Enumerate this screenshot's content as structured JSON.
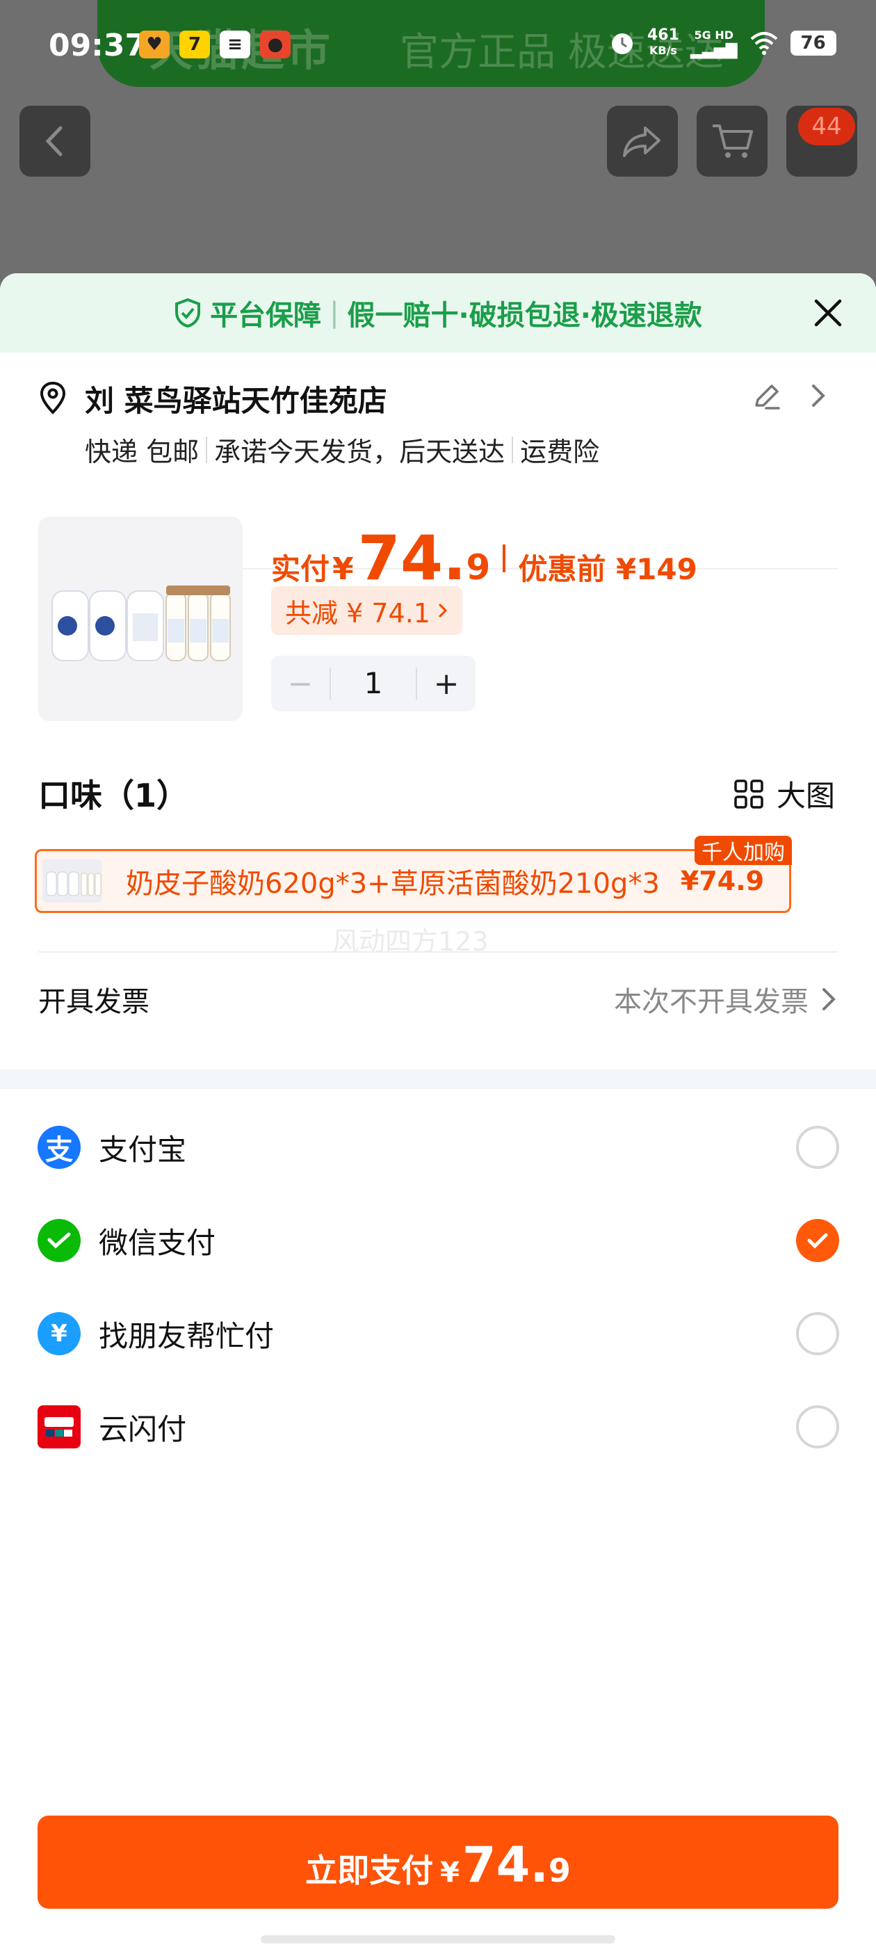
{
  "status_bar": {
    "time": "09:37",
    "net_speed": "461",
    "net_unit": "KB/s",
    "network": "5G HD",
    "battery": "76"
  },
  "background_page": {
    "banner_brand": "天猫超市",
    "banner_slogan": "官方正品 极速送达",
    "cart_badge": "44"
  },
  "guarantee": {
    "left": "平台保障",
    "right": "假一赔十·破损包退·极速退款"
  },
  "address": {
    "name": "刘 菜鸟驿站天竹佳苑店",
    "delivery": [
      "快递 包邮",
      "承诺今天发货，后天送达",
      "运费险"
    ]
  },
  "product": {
    "price_label": "实付",
    "currency": "¥",
    "price_int": "74.",
    "price_dec": "9",
    "original_label": "优惠前 ¥149",
    "discount": "共减 ¥ 74.1",
    "quantity": "1"
  },
  "flavor": {
    "heading": "口味（1）",
    "big_image_label": "大图",
    "variant_text": "奶皮子酸奶620g*3+草原活菌酸奶210g*3",
    "variant_price": "¥74.9",
    "variant_badge": "千人加购",
    "watermark": "风动四方123"
  },
  "invoice": {
    "label": "开具发票",
    "value": "本次不开具发票"
  },
  "payment_methods": [
    {
      "label": "支付宝",
      "icon": "alipay-icon",
      "color": "#1677ff",
      "selected": false
    },
    {
      "label": "微信支付",
      "icon": "wechat-pay-icon",
      "color": "#09bb07",
      "selected": true
    },
    {
      "label": "找朋友帮忙付",
      "icon": "friend-pay-icon",
      "color": "#1a9fff",
      "selected": false
    },
    {
      "label": "云闪付",
      "icon": "unionpay-icon",
      "color": "#e60012",
      "selected": false
    }
  ],
  "pay_button": {
    "label": "立即支付",
    "currency": "¥",
    "int": "74.",
    "dec": "9"
  },
  "colors": {
    "accent": "#ff5308",
    "guarantee_green": "#1a9e4a"
  }
}
